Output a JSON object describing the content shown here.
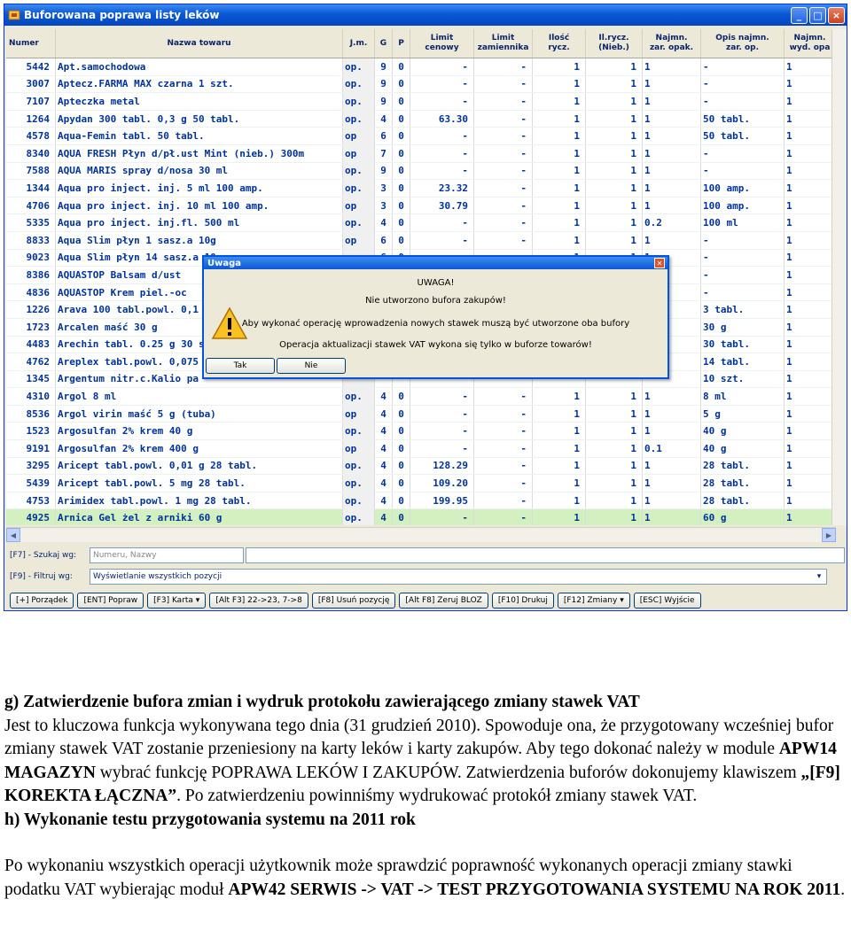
{
  "window": {
    "title": "Buforowana poprawa listy leków",
    "minimize_glyph": "_",
    "maximize_glyph": "□",
    "close_glyph": "×"
  },
  "columns": [
    {
      "label": "Numer"
    },
    {
      "label": "Nazwa towaru"
    },
    {
      "label": "J.m."
    },
    {
      "label": "G"
    },
    {
      "label": "P"
    },
    {
      "label": "Limit\ncenowy"
    },
    {
      "label": "Limit\nzamiennika"
    },
    {
      "label": "Ilość\nrycz."
    },
    {
      "label": "Il.rycz.\n(Nieb.)"
    },
    {
      "label": "Najmn.\nzar. opak."
    },
    {
      "label": "Opis najmn.\nzar. op."
    },
    {
      "label": "Najmn.\nwyd. opa"
    }
  ],
  "rows": [
    {
      "n": "5442",
      "name": "Apt.samochodowa",
      "jm": "op.",
      "g": "9",
      "p": "0",
      "lc": "-",
      "lz": "-",
      "ir": "1",
      "irn": "1",
      "nz": "1",
      "opis": "-",
      "nw": "1"
    },
    {
      "n": "3007",
      "name": "Aptecz.FARMA MAX czarna 1 szt.",
      "jm": "op.",
      "g": "9",
      "p": "0",
      "lc": "-",
      "lz": "-",
      "ir": "1",
      "irn": "1",
      "nz": "1",
      "opis": "-",
      "nw": "1"
    },
    {
      "n": "7107",
      "name": "Apteczka metal",
      "jm": "op.",
      "g": "9",
      "p": "0",
      "lc": "-",
      "lz": "-",
      "ir": "1",
      "irn": "1",
      "nz": "1",
      "opis": "-",
      "nw": "1"
    },
    {
      "n": "1264",
      "name": "Apydan 300 tabl. 0,3 g 50 tabl.",
      "jm": "op.",
      "g": "4",
      "p": "0",
      "lc": "63.30",
      "lz": "-",
      "ir": "1",
      "irn": "1",
      "nz": "1",
      "opis": "50 tabl.",
      "nw": "1"
    },
    {
      "n": "4578",
      "name": "Aqua-Femin tabl. 50 tabl.",
      "jm": "op",
      "g": "6",
      "p": "0",
      "lc": "-",
      "lz": "-",
      "ir": "1",
      "irn": "1",
      "nz": "1",
      "opis": "50 tabl.",
      "nw": "1"
    },
    {
      "n": "8340",
      "name": "AQUA FRESH Płyn d/pł.ust Mint (nieb.) 300m",
      "jm": "op",
      "g": "7",
      "p": "0",
      "lc": "-",
      "lz": "-",
      "ir": "1",
      "irn": "1",
      "nz": "1",
      "opis": "-",
      "nw": "1"
    },
    {
      "n": "7588",
      "name": "AQUA MARIS spray d/nosa 30 ml",
      "jm": "op.",
      "g": "9",
      "p": "0",
      "lc": "-",
      "lz": "-",
      "ir": "1",
      "irn": "1",
      "nz": "1",
      "opis": "-",
      "nw": "1"
    },
    {
      "n": "1344",
      "name": "Aqua pro inject. inj.  5 ml 100 amp.",
      "jm": "op.",
      "g": "3",
      "p": "0",
      "lc": "23.32",
      "lz": "-",
      "ir": "1",
      "irn": "1",
      "nz": "1",
      "opis": "100 amp.",
      "nw": "1"
    },
    {
      "n": "4706",
      "name": "Aqua pro inject. inj. 10 ml 100 amp.",
      "jm": "op",
      "g": "3",
      "p": "0",
      "lc": "30.79",
      "lz": "-",
      "ir": "1",
      "irn": "1",
      "nz": "1",
      "opis": "100 amp.",
      "nw": "1"
    },
    {
      "n": "5335",
      "name": "Aqua pro inject. inj.fl. 500 ml",
      "jm": "op.",
      "g": "4",
      "p": "0",
      "lc": "-",
      "lz": "-",
      "ir": "1",
      "irn": "1",
      "nz": "0.2",
      "opis": "100 ml",
      "nw": "1"
    },
    {
      "n": "8833",
      "name": "Aqua Slim płyn 1 sasz.a 10g",
      "jm": "op",
      "g": "6",
      "p": "0",
      "lc": "-",
      "lz": "-",
      "ir": "1",
      "irn": "1",
      "nz": "1",
      "opis": "-",
      "nw": "1"
    },
    {
      "n": "9023",
      "name": "Aqua Slim płyn 14 sasz.a 10g",
      "jm": "op.",
      "g": "6",
      "p": "0",
      "lc": "-",
      "lz": "-",
      "ir": "1",
      "irn": "1",
      "nz": "1",
      "opis": "-",
      "nw": "1"
    },
    {
      "n": "8386",
      "name": "AQUASTOP Balsam d/ust",
      "jm": "",
      "g": "",
      "p": "",
      "lc": "",
      "lz": "",
      "ir": "",
      "irn": "",
      "nz": "",
      "opis": "-",
      "nw": "1"
    },
    {
      "n": "4836",
      "name": "AQUASTOP Krem piel.-oc",
      "jm": "",
      "g": "",
      "p": "",
      "lc": "",
      "lz": "",
      "ir": "",
      "irn": "",
      "nz": "",
      "opis": "-",
      "nw": "1"
    },
    {
      "n": "1226",
      "name": "Arava 100 tabl.powl. 0,1",
      "jm": "",
      "g": "",
      "p": "",
      "lc": "",
      "lz": "",
      "ir": "",
      "irn": "",
      "nz": "",
      "opis": "3 tabl.",
      "nw": "1"
    },
    {
      "n": "1723",
      "name": "Arcalen maść 30 g",
      "jm": "",
      "g": "",
      "p": "",
      "lc": "",
      "lz": "",
      "ir": "",
      "irn": "",
      "nz": "",
      "opis": "30 g",
      "nw": "1"
    },
    {
      "n": "4483",
      "name": "Arechin tabl. 0.25 g 30 sz",
      "jm": "",
      "g": "",
      "p": "",
      "lc": "",
      "lz": "",
      "ir": "",
      "irn": "",
      "nz": "",
      "opis": "30 tabl.",
      "nw": "1"
    },
    {
      "n": "4762",
      "name": "Areplex tabl.powl. 0,075",
      "jm": "",
      "g": "",
      "p": "",
      "lc": "",
      "lz": "",
      "ir": "",
      "irn": "",
      "nz": "",
      "opis": "14 tabl.",
      "nw": "1"
    },
    {
      "n": "1345",
      "name": "Argentum nitr.c.Kalio  pa",
      "jm": "",
      "g": "",
      "p": "",
      "lc": "",
      "lz": "",
      "ir": "",
      "irn": "",
      "nz": "",
      "opis": "10 szt.",
      "nw": "1"
    },
    {
      "n": "4310",
      "name": "Argol 8 ml",
      "jm": "op.",
      "g": "4",
      "p": "0",
      "lc": "-",
      "lz": "-",
      "ir": "1",
      "irn": "1",
      "nz": "1",
      "opis": "8 ml",
      "nw": "1"
    },
    {
      "n": "8536",
      "name": "Argol virin maść 5 g (tuba)",
      "jm": "op",
      "g": "4",
      "p": "0",
      "lc": "-",
      "lz": "-",
      "ir": "1",
      "irn": "1",
      "nz": "1",
      "opis": "5 g",
      "nw": "1"
    },
    {
      "n": "1523",
      "name": "Argosulfan 2% krem 40 g",
      "jm": "op.",
      "g": "4",
      "p": "0",
      "lc": "-",
      "lz": "-",
      "ir": "1",
      "irn": "1",
      "nz": "1",
      "opis": "40 g",
      "nw": "1"
    },
    {
      "n": "9191",
      "name": "Argosulfan 2% krem 400 g",
      "jm": "op",
      "g": "4",
      "p": "0",
      "lc": "-",
      "lz": "-",
      "ir": "1",
      "irn": "1",
      "nz": "0.1",
      "opis": "40 g",
      "nw": "1"
    },
    {
      "n": "3295",
      "name": "Aricept tabl.powl. 0,01 g 28 tabl.",
      "jm": "op.",
      "g": "4",
      "p": "0",
      "lc": "128.29",
      "lz": "-",
      "ir": "1",
      "irn": "1",
      "nz": "1",
      "opis": "28 tabl.",
      "nw": "1"
    },
    {
      "n": "5439",
      "name": "Aricept tabl.powl. 5 mg 28 tabl.",
      "jm": "op.",
      "g": "4",
      "p": "0",
      "lc": "109.20",
      "lz": "-",
      "ir": "1",
      "irn": "1",
      "nz": "1",
      "opis": "28 tabl.",
      "nw": "1"
    },
    {
      "n": "4753",
      "name": "Arimidex tabl.powl. 1 mg 28 tabl.",
      "jm": "op.",
      "g": "4",
      "p": "0",
      "lc": "199.95",
      "lz": "-",
      "ir": "1",
      "irn": "1",
      "nz": "1",
      "opis": "28 tabl.",
      "nw": "1"
    },
    {
      "n": "4925",
      "name": "Arnica Gel żel z arniki 60 g",
      "jm": "op.",
      "g": "4",
      "p": "0",
      "lc": "-",
      "lz": "-",
      "ir": "1",
      "irn": "1",
      "nz": "1",
      "opis": "60 g",
      "nw": "1"
    }
  ],
  "filters": {
    "search_label": "[F7] - Szukaj wg:",
    "search_mode": "Numeru, Nazwy",
    "filter_label": "[F9] - Filtruj wg:",
    "filter_value": "Wyświetlanie wszystkich pozycji"
  },
  "buttons": [
    "[+] Porządek",
    "[ENT] Popraw",
    "[F3] Karta ▾",
    "[Alt F3] 22->23, 7->8",
    "[F8] Usuń pozycję",
    "[Alt F8] Zeruj BLOZ",
    "[F10] Drukuj",
    "[F12] Zmiany ▾",
    "[ESC] Wyjście"
  ],
  "dialog": {
    "title": "Uwaga",
    "heading": "UWAGA!",
    "line1": "Nie utworzono bufora zakupów!",
    "line2": "Aby wykonać operację wprowadzenia nowych stawek muszą być utworzone oba bufory",
    "line3": "Operacja aktualizacji stawek VAT wykona się tylko w buforze towarów!",
    "yes": "Tak",
    "no": "Nie"
  },
  "document": {
    "g_heading": "g) Zatwierdzenie bufora zmian i wydruk protokołu zawierającego zmiany stawek VAT",
    "g_text1": "Jest to kluczowa funkcja wykonywana tego dnia (31 grudzień 2010). Spowoduje ona, że przygotowany wcześniej bufor zmiany stawek VAT zostanie przeniesiony na karty leków i karty zakupów. Aby tego dokonać należy w module ",
    "g_bold1": "APW14 MAGAZYN",
    "g_text2": " wybrać funkcję POPRAWA LEKÓW I ZAKUPÓW. Zatwierdzenia buforów dokonujemy klawiszem ",
    "g_bold2": "„[F9] KOREKTA ŁĄCZNA”",
    "g_text3": ". Po zatwierdzeniu powinniśmy wydrukować protokół zmiany stawek VAT.",
    "h_heading": "h) Wykonanie testu przygotowania systemu na 2011 rok",
    "h_text1": "Po wykonaniu wszystkich operacji użytkownik może sprawdzić poprawność wykonanych operacji zmiany stawki podatku VAT wybierając moduł ",
    "h_bold1": "APW42 SERWIS -> VAT -> TEST PRZYGOTOWANIA SYSTEMU NA ROK 2011",
    "h_text2": "."
  }
}
